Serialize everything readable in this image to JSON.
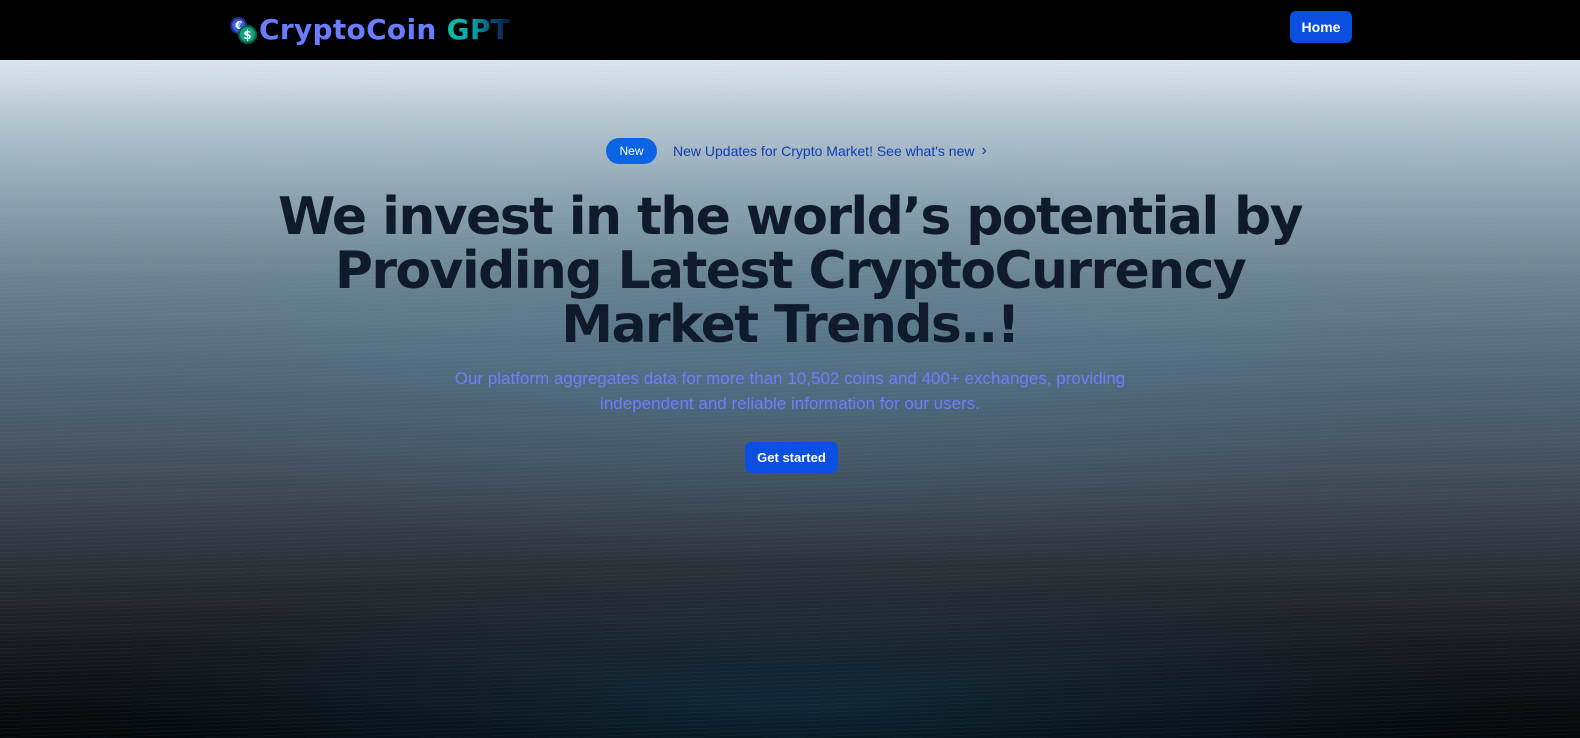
{
  "navbar": {
    "brand": {
      "name": "CryptoCoin",
      "suffix": "GPT",
      "icon": "coins-icon"
    },
    "home_label": "Home"
  },
  "hero": {
    "badge": "New",
    "announcement": "New Updates for Crypto Market! See what's new",
    "announcement_icon": "chevron-right-icon",
    "headline": "We invest in the world’s potential by Providing Latest CryptoCurrency Market Trends..!",
    "subheadline": "Our platform aggregates data for more than 10,502 coins and 400+ exchanges, providing independent and reliable information for our users.",
    "cta_label": "Get started"
  },
  "colors": {
    "primary": "#0b4fe0",
    "badge": "#0b63e6",
    "brand_text": "#6a7cff",
    "brand_gpt": "#06c2a4",
    "headline": "#0f1b2b",
    "subheadline": "#6f7cff",
    "navbar_bg": "#000000"
  }
}
